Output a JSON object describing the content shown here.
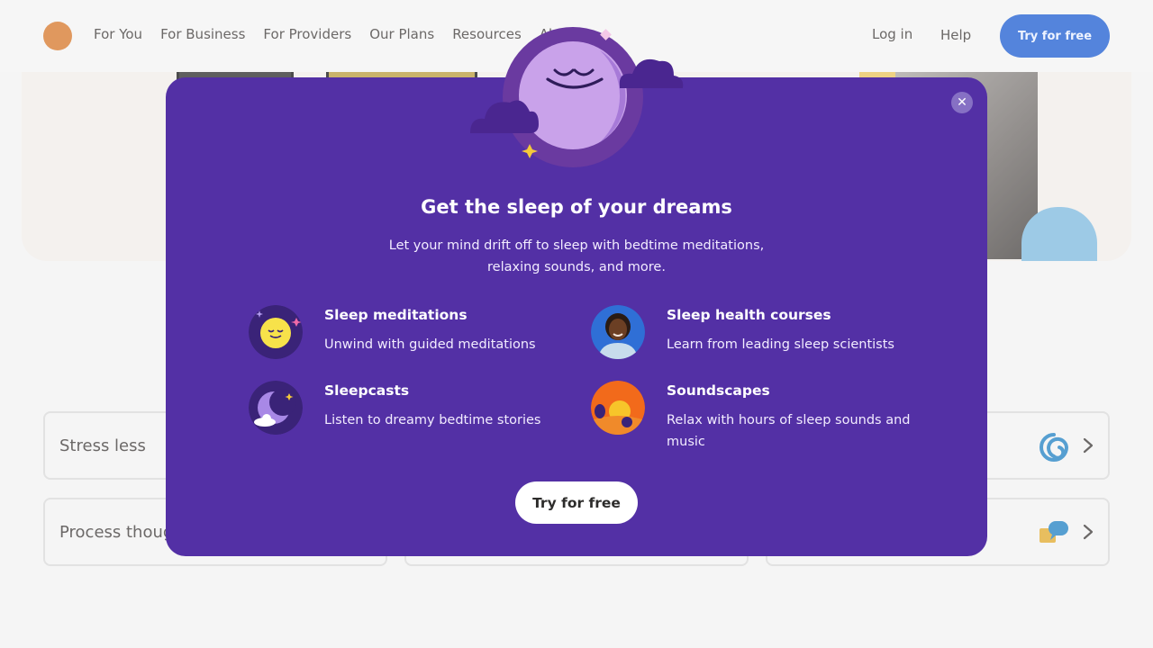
{
  "header": {
    "nav": [
      "For You",
      "For Business",
      "For Providers",
      "Our Plans",
      "Resources",
      "Ab"
    ],
    "login_label": "Log in",
    "help_label": "Help",
    "try_label": "Try for free"
  },
  "cards": [
    {
      "label": "Stress less",
      "icon": "swirl-icon"
    },
    {
      "label": "Process thoug",
      "icon": "chat-bubbles-icon"
    }
  ],
  "modal": {
    "title": "Get the sleep of your dreams",
    "subtitle_line1": "Let your mind drift off to sleep with bedtime meditations,",
    "subtitle_line2": "relaxing sounds, and more.",
    "features": [
      {
        "title": "Sleep meditations",
        "desc": "Unwind with guided meditations",
        "icon": "sleepy-moon-icon"
      },
      {
        "title": "Sleep health courses",
        "desc": "Learn from leading sleep scientists",
        "icon": "instructor-portrait"
      },
      {
        "title": "Sleepcasts",
        "desc": "Listen to dreamy bedtime stories",
        "icon": "crescent-moon-icon"
      },
      {
        "title": "Soundscapes",
        "desc": "Relax with hours of sleep sounds and music",
        "icon": "sunset-birds-icon"
      }
    ],
    "try_label": "Try for free",
    "close_icon": "close-icon"
  },
  "colors": {
    "modal_bg": "#5330a5",
    "cta_blue": "#1b5bd1",
    "logo_orange": "#d67628"
  }
}
